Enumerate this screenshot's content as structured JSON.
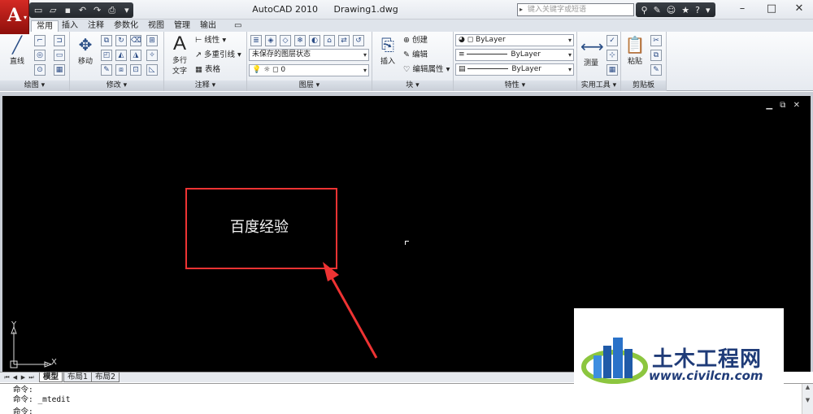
{
  "window": {
    "app_name": "AutoCAD 2010",
    "file_name": "Drawing1.dwg",
    "search_placeholder": "键入关键字或短语",
    "logo_letter": "A"
  },
  "tabs": [
    {
      "label": "常用",
      "active": true
    },
    {
      "label": "插入"
    },
    {
      "label": "注释"
    },
    {
      "label": "参数化"
    },
    {
      "label": "视图"
    },
    {
      "label": "管理"
    },
    {
      "label": "输出"
    }
  ],
  "ribbon": {
    "draw": {
      "panel_label": "绘图",
      "line_label": "直线"
    },
    "modify": {
      "panel_label": "修改",
      "move_label": "移动"
    },
    "annotation": {
      "panel_label": "注释",
      "mtext_label_1": "多行",
      "mtext_label_2": "文字",
      "linear_label": "线性",
      "multileader_label": "多重引线",
      "table_label": "表格"
    },
    "layers": {
      "panel_label": "图层",
      "layer_state": "未保存的图层状态",
      "current_layer": "0"
    },
    "block": {
      "panel_label": "块",
      "insert_label": "插入",
      "create_label": "创建",
      "edit_label": "编辑",
      "edit_attr_label": "编辑属性"
    },
    "properties": {
      "panel_label": "特性",
      "color": "ByLayer",
      "linetype": "ByLayer",
      "lineweight": "ByLayer"
    },
    "utilities": {
      "panel_label": "实用工具",
      "measure_label": "测量"
    },
    "clipboard": {
      "panel_label": "剪贴板",
      "paste_label": "粘贴"
    }
  },
  "canvas": {
    "mtext": "百度经验",
    "ucs_y": "Y",
    "ucs_x": "X",
    "background_color": "#000000",
    "highlight_color": "#e33333"
  },
  "layout_tabs": [
    {
      "label": "模型",
      "active": true
    },
    {
      "label": "布局1"
    },
    {
      "label": "布局2"
    }
  ],
  "command_line": {
    "line1": "命令:",
    "line2": "命令: _mtedit",
    "line3": "命令:"
  },
  "watermark": {
    "name": "土木工程网",
    "url": "www.civilcn.com"
  }
}
